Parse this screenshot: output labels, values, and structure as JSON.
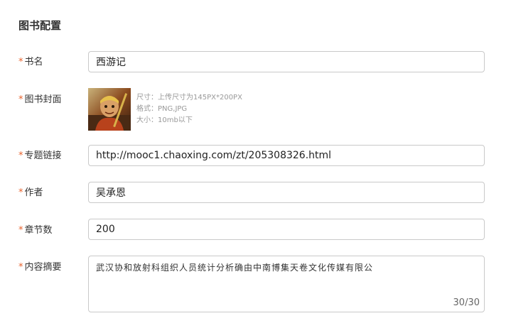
{
  "section_title": "图书配置",
  "required_mark": "*",
  "fields": {
    "book_name": {
      "label": "书名",
      "value": "西游记"
    },
    "cover": {
      "label": "图书封面",
      "hint_size": "尺寸：上传尺寸为145PX*200PX",
      "hint_format": "格式：PNG,JPG",
      "hint_filesize": "大小：10mb以下"
    },
    "topic_link": {
      "label": "专题链接",
      "value": "http://mooc1.chaoxing.com/zt/205308326.html"
    },
    "author": {
      "label": "作者",
      "value": "吴承恩"
    },
    "chapter_count": {
      "label": "章节数",
      "value": "200"
    },
    "summary": {
      "label": "内容摘要",
      "value": "武汉协和放射科组织人员统计分析确由中南博集天卷文化传媒有限公",
      "counter": "30/30"
    }
  },
  "colors": {
    "required_star": "#e8622c",
    "input_border": "#c9c9c9",
    "hint_text": "#999999"
  }
}
